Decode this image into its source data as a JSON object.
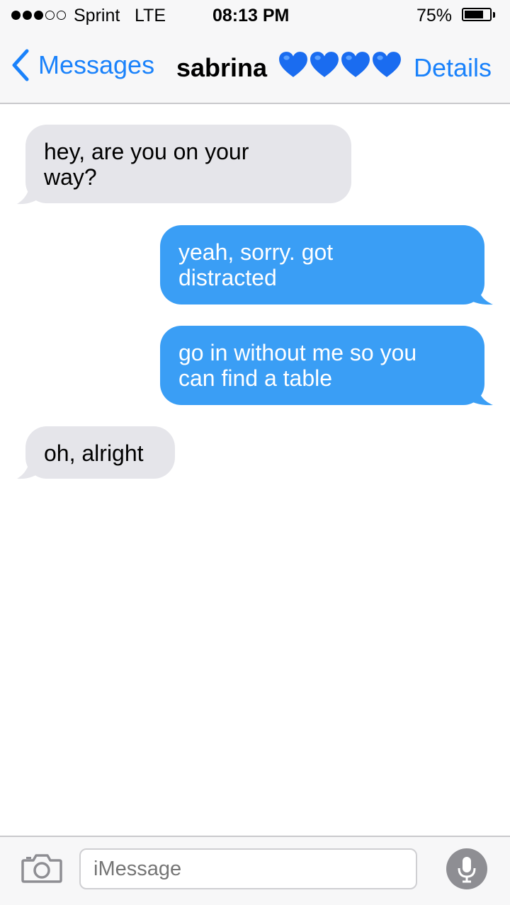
{
  "status_bar": {
    "signal_filled": 3,
    "signal_total": 5,
    "carrier": "Sprint",
    "network": "LTE",
    "time": "08:13 PM",
    "battery_percent_label": "75%",
    "battery_level": 0.75
  },
  "nav": {
    "back_label": "Messages",
    "contact_name": "sabrina",
    "contact_emoji": [
      "blue-heart",
      "blue-heart",
      "blue-heart",
      "blue-heart"
    ],
    "details_label": "Details"
  },
  "messages": [
    {
      "direction": "incoming",
      "lines": [
        "hey, are you on your",
        "way?"
      ]
    },
    {
      "direction": "outgoing",
      "lines": [
        "yeah, sorry. got",
        "distracted"
      ]
    },
    {
      "direction": "outgoing",
      "lines": [
        "go in without me so you",
        "can find a table"
      ]
    },
    {
      "direction": "incoming",
      "lines": [
        "oh, alright"
      ]
    }
  ],
  "composer": {
    "placeholder": "iMessage",
    "camera_icon": "camera-icon",
    "mic_icon": "microphone-icon"
  },
  "colors": {
    "accent": "#1a82fb",
    "outgoing_bubble": "#3a9ef5",
    "incoming_bubble": "#e5e5ea",
    "heart": "#1a6cf0"
  }
}
